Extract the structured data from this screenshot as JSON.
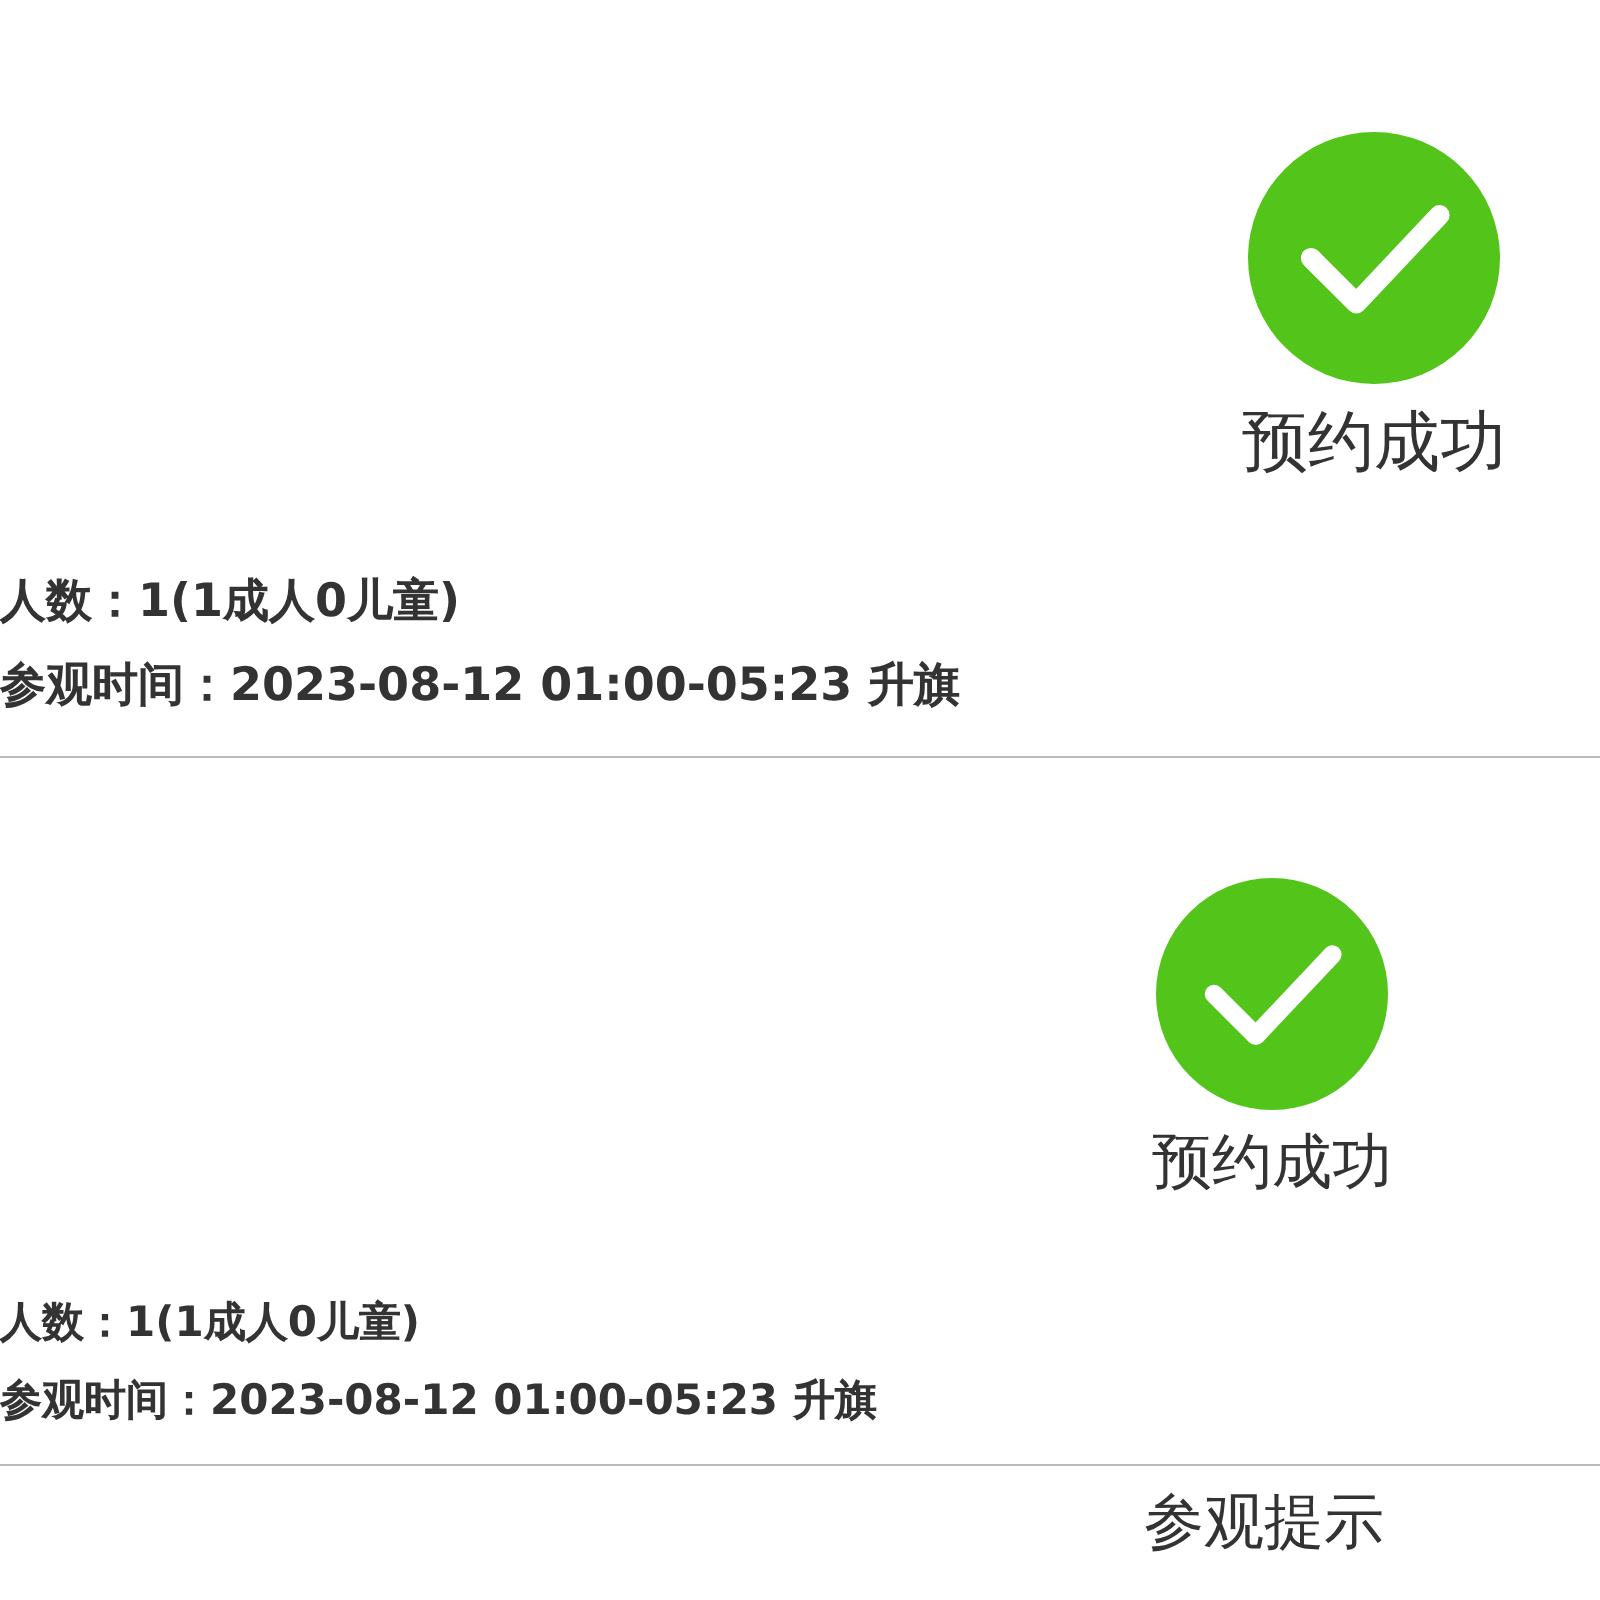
{
  "panels": [
    {
      "kind": "success",
      "caption": "预约成功",
      "details": [
        "人数：1(1成人0儿童)",
        "参观时间：2023-08-12 01:00-05:23 升旗"
      ]
    },
    {
      "kind": "success",
      "caption": "预约成功",
      "details": [
        "人数：1(1成人0儿童)",
        "参观时间：2023-08-12 01:00-05:23 升旗"
      ]
    }
  ],
  "next_section_title": "参观提示"
}
